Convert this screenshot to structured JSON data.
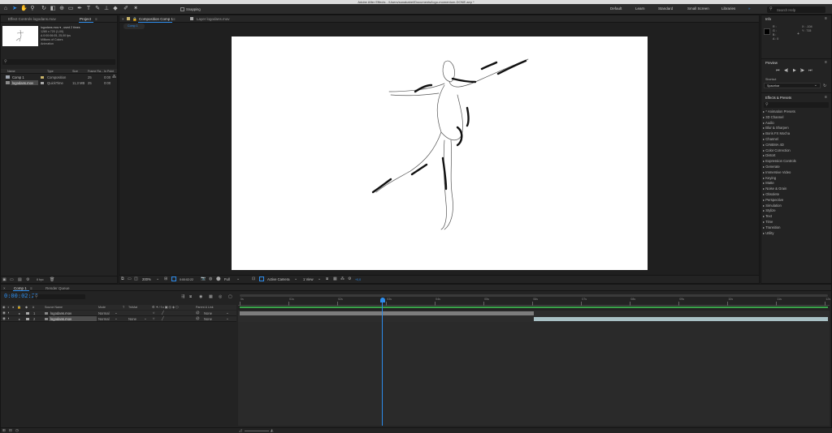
{
  "window": {
    "title": "Adobe After Effects - /Users/sunakabei/Documents/logo-momentum-DONE.aep *"
  },
  "toolbar": {
    "snapping_label": "Snapping",
    "workspaces": [
      "Default",
      "Learn",
      "Standard",
      "Small Screen",
      "Libraries"
    ],
    "search_placeholder": "Search Help",
    "tool_icons": [
      "home-icon",
      "selection-tool-icon",
      "hand-tool-icon",
      "zoom-tool-icon",
      "rotation-tool-icon",
      "camera-tool-icon",
      "pan-behind-tool-icon",
      "rectangle-tool-icon",
      "pen-tool-icon",
      "type-tool-icon",
      "brush-tool-icon",
      "clone-stamp-tool-icon",
      "eraser-tool-icon",
      "roto-brush-tool-icon",
      "puppet-pin-tool-icon"
    ]
  },
  "project_panel": {
    "tab_effect_controls": "Effect Controls logodans.mov",
    "tab_project": "Project",
    "info": {
      "name": "logodans.mov ▾ , used 2 times",
      "size": "1280 x 720 (1,00)",
      "duration": "Δ 0:00:06:05, 25,00 fps",
      "colors": "Millions of Colors",
      "codec": "Animation"
    },
    "search_placeholder": "",
    "columns": [
      "Name",
      "Type",
      "Size",
      "Frame Ra...",
      "In Point"
    ],
    "items": [
      {
        "name": "Comp 1",
        "type": "Composition",
        "size": "",
        "fps": "25",
        "in": "0:00",
        "label_color": "#c9b46a"
      },
      {
        "name": "logodans.mov",
        "type": "QuickTime",
        "size": "11,3 MB",
        "fps": "25",
        "in": "0:00",
        "label_color": "#a8a8a8"
      }
    ],
    "bit_depth": "8 bpc"
  },
  "viewer": {
    "tab_composition": "Composition Comp 1",
    "tab_layer": "Layer logodans.mov",
    "comp_chip": "Comp 1",
    "zoom": "200%",
    "timecode": "0:00:02:22",
    "resolution": "Full",
    "camera": "Active Camera",
    "views": "1 View",
    "exposure": "+0,0"
  },
  "info_panel": {
    "title": "Info",
    "r": "R :",
    "g": "G :",
    "b": "B :",
    "a": "A : 0",
    "x": "X : -104",
    "y": "Y : 715"
  },
  "preview_panel": {
    "title": "Preview",
    "shortcut_label": "Shortcut",
    "shortcut_value": "Spacebar"
  },
  "effects_panel": {
    "title": "Effects & Presets",
    "search_placeholder": "",
    "categories": [
      "* Animation Presets",
      "3D Channel",
      "Audio",
      "Blur & Sharpen",
      "Boris FX Mocha",
      "Channel",
      "CINEMA 4D",
      "Color Correction",
      "Distort",
      "Expression Controls",
      "Generate",
      "Immersive Video",
      "Keying",
      "Matte",
      "Noise & Grain",
      "Obsolete",
      "Perspective",
      "Simulation",
      "Stylize",
      "Text",
      "Time",
      "Transition",
      "Utility"
    ]
  },
  "timeline": {
    "tab_comp": "Comp 1",
    "tab_render": "Render Queue",
    "timecode": "0:00:02:22",
    "search_placeholder": "",
    "columns": [
      "Source Name",
      "Mode",
      "T",
      "TrkMat",
      "Parent & Link"
    ],
    "layers": [
      {
        "num": "1",
        "name": "logodans.mov",
        "mode": "Normal",
        "trkmat": "",
        "parent": "None",
        "selected": false
      },
      {
        "num": "2",
        "name": "logodans.mov",
        "mode": "Normal",
        "trkmat": "None",
        "parent": "None",
        "selected": true
      }
    ],
    "ruler_labels": [
      "0s",
      "01s",
      "02s",
      "03s",
      "04s",
      "05s",
      "06s",
      "07s",
      "08s",
      "09s",
      "10s",
      "11s",
      "12s"
    ],
    "playhead_fraction": 0.242,
    "layer1_bar": {
      "start_fraction": 0.0,
      "end_fraction": 0.5
    },
    "layer2_bar": {
      "start_fraction": 0.5,
      "end_fraction": 1.0
    }
  }
}
